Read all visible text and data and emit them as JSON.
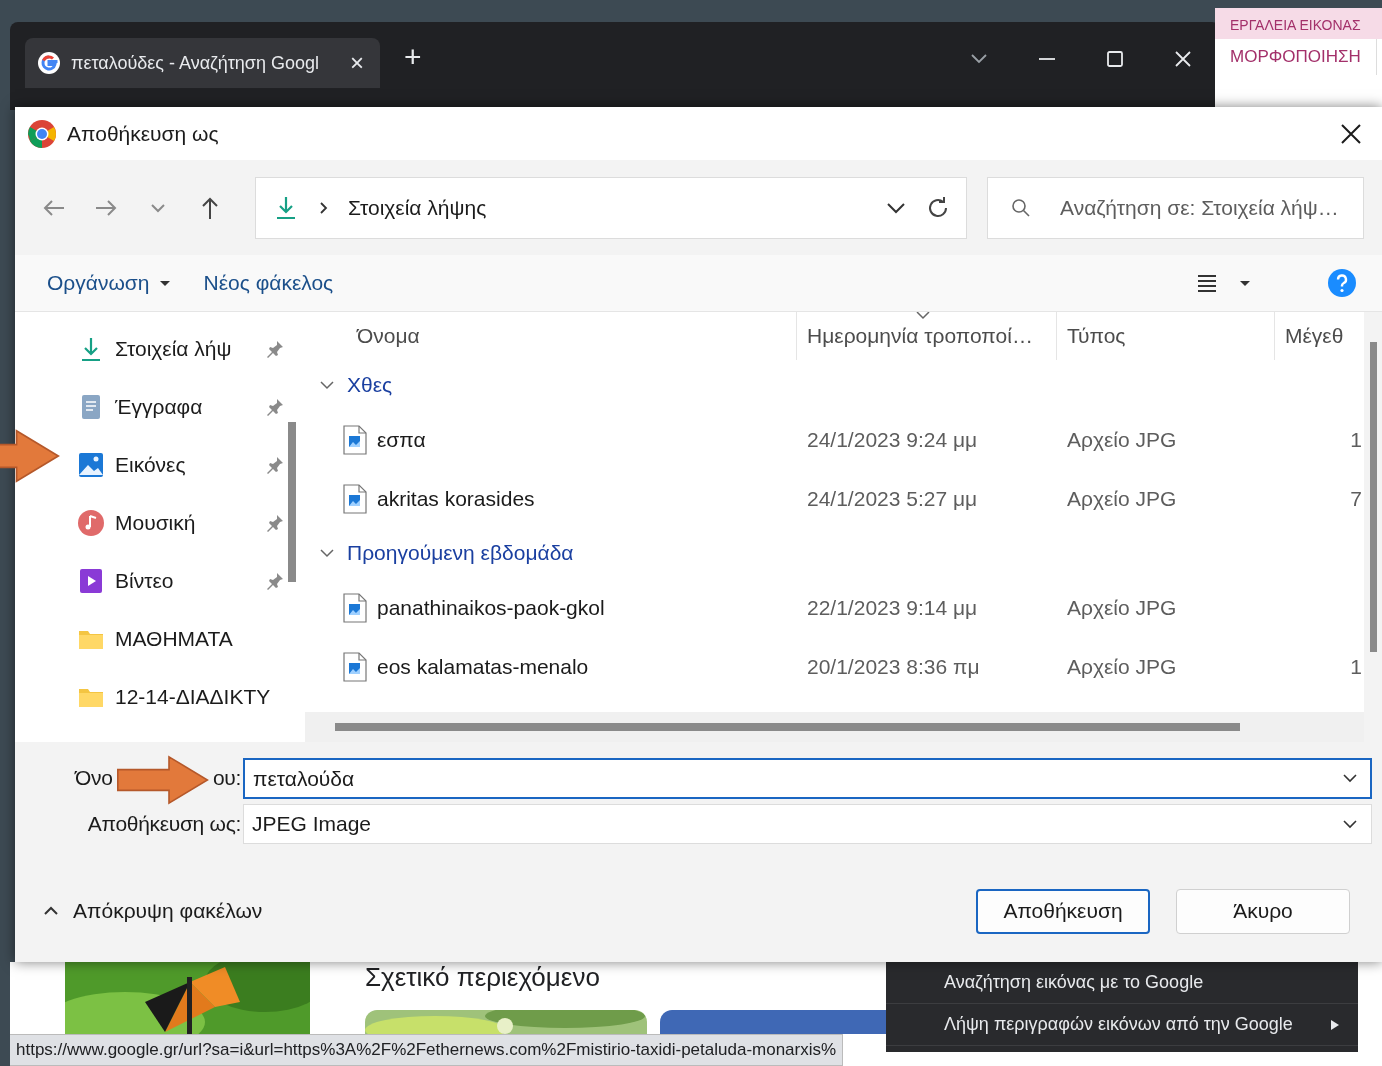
{
  "browser": {
    "tab": {
      "title": "πεταλούδες - Αναζήτηση Googl",
      "close": "×"
    },
    "new_tab": "+"
  },
  "word_ribbon": {
    "group_label": "ΕΡΓΑΛΕΙΑ ΕΙΚΟΝΑΣ",
    "tab": "ΜΟΡΦΟΠΟΙΗΣΗ"
  },
  "dialog": {
    "title": "Αποθήκευση ως",
    "address": {
      "path": "Στοιχεία λήψης"
    },
    "search": {
      "placeholder": "Αναζήτηση σε: Στοιχεία λήψ…"
    },
    "toolbar": {
      "organize": "Οργάνωση",
      "new_folder": "Νέος φάκελος"
    },
    "sidebar": {
      "items": [
        {
          "label": "Στοιχεία λήψ",
          "kind": "downloads",
          "pinned": true
        },
        {
          "label": "Έγγραφα",
          "kind": "documents",
          "pinned": true
        },
        {
          "label": "Εικόνες",
          "kind": "pictures",
          "pinned": true
        },
        {
          "label": "Μουσική",
          "kind": "music",
          "pinned": true
        },
        {
          "label": "Βίντεο",
          "kind": "videos",
          "pinned": true
        },
        {
          "label": "ΜΑΘΗΜΑΤΑ",
          "kind": "folder",
          "pinned": false
        },
        {
          "label": "12-14-ΔΙΑΔΙΚΤΥ",
          "kind": "folder",
          "pinned": false
        }
      ]
    },
    "file_list": {
      "columns": [
        {
          "label": "Όνομα",
          "sorted": false
        },
        {
          "label": "Ημερομηνία τροποποί…",
          "sorted": true
        },
        {
          "label": "Τύπος",
          "sorted": false
        },
        {
          "label": "Μέγεθ",
          "sorted": false
        }
      ],
      "groups": [
        {
          "label": "Χθες",
          "expanded": true,
          "rows": [
            {
              "name": "εσπα",
              "date": "24/1/2023 9:24 μμ",
              "type": "Αρχείο JPG",
              "size": "1"
            },
            {
              "name": "akritas korasides",
              "date": "24/1/2023 5:27 μμ",
              "type": "Αρχείο JPG",
              "size": "7"
            }
          ]
        },
        {
          "label": "Προηγούμενη εβδομάδα",
          "expanded": true,
          "rows": [
            {
              "name": "panathinaikos-paok-gkol",
              "date": "22/1/2023 9:14 μμ",
              "type": "Αρχείο JPG"
            },
            {
              "name": "eos kalamatas-menalo",
              "date": "20/1/2023 8:36 πμ",
              "type": "Αρχείο JPG",
              "size": "1"
            }
          ]
        }
      ]
    },
    "file_name": {
      "label_start": "Όνο",
      "label_end": "ου:",
      "value": "πεταλούδα"
    },
    "save_as_type": {
      "label": "Αποθήκευση ως:",
      "value": "JPEG Image"
    },
    "hide_folders": "Απόκρυψη φακέλων",
    "buttons": [
      {
        "label": "Αποθήκευση",
        "default": true
      },
      {
        "label": "Άκυρο",
        "default": false
      }
    ]
  },
  "page_behind": {
    "related_heading": "Σχετικό περιεχόμενο",
    "context_menu": [
      {
        "label": "Αναζήτηση εικόνας με το Google",
        "submenu": false
      },
      {
        "label": "Λήψη περιγραφών εικόνων από την Google",
        "submenu": true
      }
    ],
    "status_url": "https://www.google.gr/url?sa=i&url=https%3A%2F%2Fethernews.com%2Fmistirio-taxidi-petaluda-monarxis%"
  }
}
